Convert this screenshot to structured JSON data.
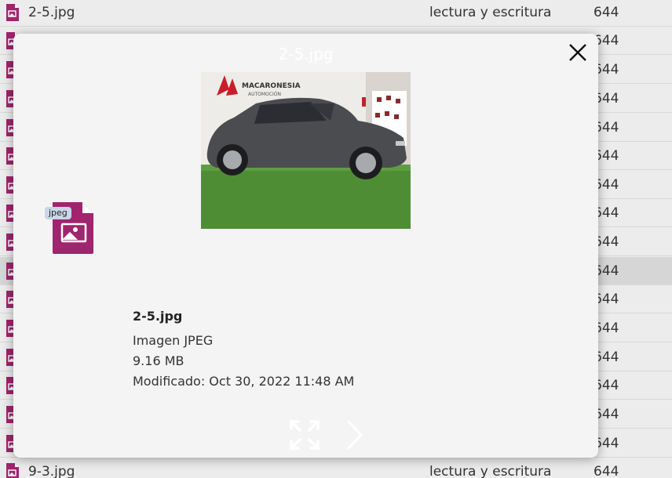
{
  "file_list": {
    "rows": [
      {
        "name": "2-5.jpg",
        "perms": "lectura y escritura",
        "mode": "644"
      },
      {
        "name": "",
        "perms": "",
        "mode": "644"
      },
      {
        "name": "",
        "perms": "",
        "mode": "644"
      },
      {
        "name": "",
        "perms": "",
        "mode": "644"
      },
      {
        "name": "",
        "perms": "",
        "mode": "644"
      },
      {
        "name": "",
        "perms": "",
        "mode": "644"
      },
      {
        "name": "",
        "perms": "",
        "mode": "644"
      },
      {
        "name": "",
        "perms": "",
        "mode": "644"
      },
      {
        "name": "",
        "perms": "",
        "mode": "644"
      },
      {
        "name": "",
        "perms": "",
        "mode": "644"
      },
      {
        "name": "",
        "perms": "",
        "mode": "644"
      },
      {
        "name": "",
        "perms": "",
        "mode": "644"
      },
      {
        "name": "",
        "perms": "",
        "mode": "644"
      },
      {
        "name": "",
        "perms": "",
        "mode": "644"
      },
      {
        "name": "",
        "perms": "",
        "mode": "644"
      },
      {
        "name": "",
        "perms": "",
        "mode": "644"
      },
      {
        "name": "9-3.jpg",
        "perms": "lectura y escritura",
        "mode": "644"
      }
    ],
    "selected_row": 9,
    "file_icon": "image-file-icon"
  },
  "preview_dialog": {
    "title": "2-5.jpg",
    "close_icon": "close-icon",
    "image_sign_text": "MACARONESIA",
    "image_sign_subtext": "AUTOMOCIÓN",
    "type_badge": "jpeg",
    "file_name": "2-5.jpg",
    "file_type": "Imagen JPEG",
    "file_size": "9.16 MB",
    "modified": "Modificado: Oct 30, 2022 11:48 AM",
    "expand_icon": "expand-icon",
    "next_icon": "chevron-right-icon"
  },
  "colors": {
    "file_icon": "#a0246e",
    "badge_bg": "#c9d6e8",
    "row_selected": "#d6d6d6"
  }
}
